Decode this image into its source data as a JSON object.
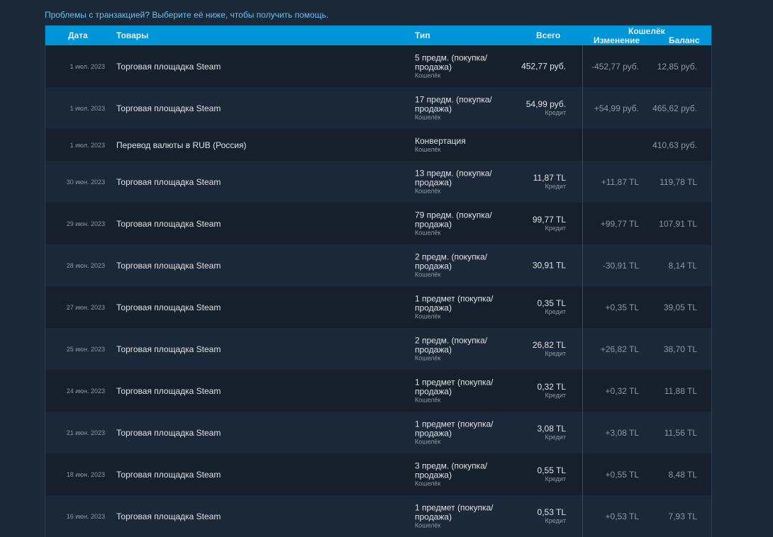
{
  "help_text": "Проблемы с транзакцией? Выберите её ниже, чтобы получить помощь.",
  "headers": {
    "date": "Дата",
    "items": "Товары",
    "type": "Тип",
    "total": "Всего",
    "wallet": "Кошелёк",
    "change": "Изменение",
    "balance": "Баланс"
  },
  "rows": [
    {
      "date": "1 июл. 2023",
      "item": "Торговая площадка Steam",
      "type": "5 предм. (покупка/ продажа)",
      "type_sub": "Кошелёк",
      "total": "452,77 руб.",
      "total_sub": "",
      "change": "-452,77 руб.",
      "balance": "12,85 руб."
    },
    {
      "date": "1 июл. 2023",
      "item": "Торговая площадка Steam",
      "type": "17 предм. (покупка/ продажа)",
      "type_sub": "Кошелёк",
      "total": "54,99 руб.",
      "total_sub": "Кредит",
      "change": "+54,99 руб.",
      "balance": "465,62 руб."
    },
    {
      "date": "1 июл. 2023",
      "item": "Перевод валюты в RUB (Россия)",
      "type": "Конвертация",
      "type_sub": "Кошелёк",
      "total": "",
      "total_sub": "",
      "change": "",
      "balance": "410,63 руб.",
      "short": true
    },
    {
      "date": "30 июн. 2023",
      "item": "Торговая площадка Steam",
      "type": "13 предм. (покупка/ продажа)",
      "type_sub": "Кошелёк",
      "total": "11,87 TL",
      "total_sub": "Кредит",
      "change": "+11,87 TL",
      "balance": "119,78 TL"
    },
    {
      "date": "29 июн. 2023",
      "item": "Торговая площадка Steam",
      "type": "79 предм. (покупка/ продажа)",
      "type_sub": "Кошелёк",
      "total": "99,77 TL",
      "total_sub": "Кредит",
      "change": "+99,77 TL",
      "balance": "107,91 TL"
    },
    {
      "date": "28 июн. 2023",
      "item": "Торговая площадка Steam",
      "type": "2 предм. (покупка/ продажа)",
      "type_sub": "Кошелёк",
      "total": "30,91 TL",
      "total_sub": "",
      "change": "-30,91 TL",
      "balance": "8,14 TL"
    },
    {
      "date": "27 июн. 2023",
      "item": "Торговая площадка Steam",
      "type": "1 предмет (покупка/ продажа)",
      "type_sub": "Кошелёк",
      "total": "0,35 TL",
      "total_sub": "Кредит",
      "change": "+0,35 TL",
      "balance": "39,05 TL"
    },
    {
      "date": "25 июн. 2023",
      "item": "Торговая площадка Steam",
      "type": "2 предм. (покупка/ продажа)",
      "type_sub": "Кошелёк",
      "total": "26,82 TL",
      "total_sub": "Кредит",
      "change": "+26,82 TL",
      "balance": "38,70 TL"
    },
    {
      "date": "24 июн. 2023",
      "item": "Торговая площадка Steam",
      "type": "1 предмет (покупка/ продажа)",
      "type_sub": "Кошелёк",
      "total": "0,32 TL",
      "total_sub": "Кредит",
      "change": "+0,32 TL",
      "balance": "11,88 TL"
    },
    {
      "date": "21 июн. 2023",
      "item": "Торговая площадка Steam",
      "type": "1 предмет (покупка/ продажа)",
      "type_sub": "Кошелёк",
      "total": "3,08 TL",
      "total_sub": "Кредит",
      "change": "+3,08 TL",
      "balance": "11,56 TL"
    },
    {
      "date": "18 июн. 2023",
      "item": "Торговая площадка Steam",
      "type": "3 предм. (покупка/ продажа)",
      "type_sub": "Кошелёк",
      "total": "0,55 TL",
      "total_sub": "Кредит",
      "change": "+0,55 TL",
      "balance": "8,48 TL"
    },
    {
      "date": "16 июн. 2023",
      "item": "Торговая площадка Steam",
      "type": "1 предмет (покупка/ продажа)",
      "type_sub": "Кошелёк",
      "total": "0,53 TL",
      "total_sub": "Кредит",
      "change": "+0,53 TL",
      "balance": "7,93 TL"
    }
  ]
}
